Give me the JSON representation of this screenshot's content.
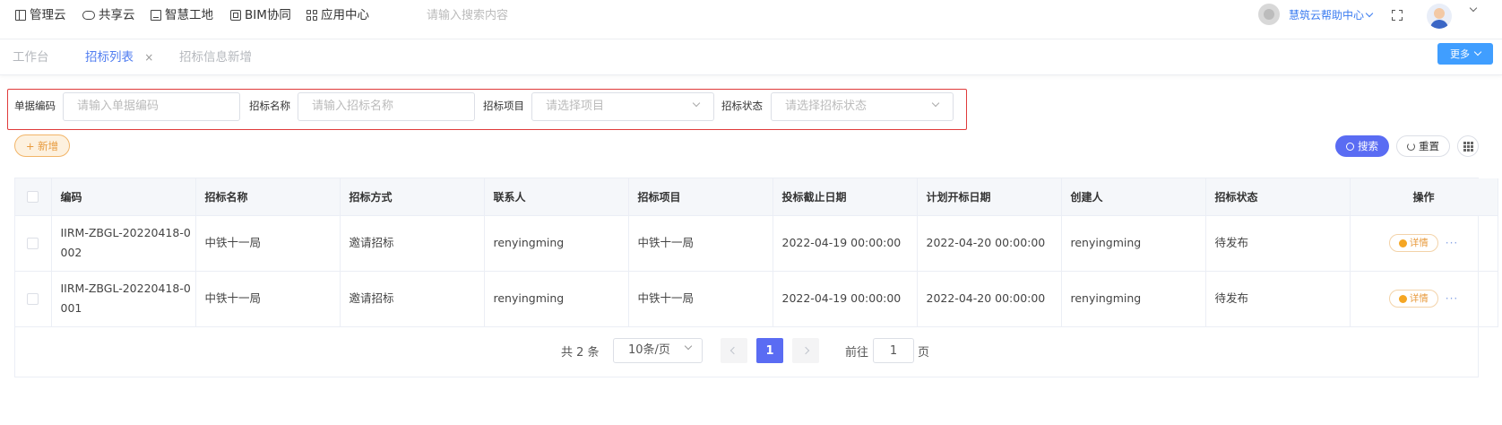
{
  "topnav": {
    "items": [
      {
        "label": "管理云",
        "icon": "book-icon"
      },
      {
        "label": "共享云",
        "icon": "cloud-icon"
      },
      {
        "label": "智慧工地",
        "icon": "site-icon"
      },
      {
        "label": "BIM协同",
        "icon": "bim-icon"
      },
      {
        "label": "应用中心",
        "icon": "grid-icon"
      }
    ],
    "search_placeholder": "请输入搜索内容",
    "help_label": "慧筑云帮助中心"
  },
  "tabs": {
    "items": [
      {
        "label": "工作台",
        "active": false
      },
      {
        "label": "招标列表",
        "active": true,
        "close": "×"
      },
      {
        "label": "招标信息新增",
        "active": false
      }
    ],
    "more_label": "更多"
  },
  "filters": {
    "code_label": "单据编码",
    "code_placeholder": "请输入单据编码",
    "name_label": "招标名称",
    "name_placeholder": "请输入招标名称",
    "project_label": "招标项目",
    "project_placeholder": "请选择项目",
    "status_label": "招标状态",
    "status_placeholder": "请选择招标状态"
  },
  "actions": {
    "add_label": "+ 新增",
    "search_label": "搜索",
    "reset_label": "重置"
  },
  "table": {
    "columns": [
      "编码",
      "招标名称",
      "招标方式",
      "联系人",
      "招标项目",
      "投标截止日期",
      "计划开标日期",
      "创建人",
      "招标状态",
      "操作"
    ],
    "rows": [
      {
        "code": "IIRM-ZBGL-20220418-0002",
        "name": "中铁十一局",
        "method": "邀请招标",
        "contact": "renyingming",
        "project": "中铁十一局",
        "deadline": "2022-04-19 00:00:00",
        "open_date": "2022-04-20 00:00:00",
        "creator": "renyingming",
        "status": "待发布"
      },
      {
        "code": "IIRM-ZBGL-20220418-0001",
        "name": "中铁十一局",
        "method": "邀请招标",
        "contact": "renyingming",
        "project": "中铁十一局",
        "deadline": "2022-04-19 00:00:00",
        "open_date": "2022-04-20 00:00:00",
        "creator": "renyingming",
        "status": "待发布"
      }
    ],
    "detail_label": "详情",
    "more_dots": "···"
  },
  "pagination": {
    "total_text": "共 2 条",
    "page_size": "10条/页",
    "current_page": "1",
    "goto_label": "前往",
    "goto_value": "1",
    "unit_label": "页"
  },
  "colors": {
    "accent": "#5a6cf3",
    "tab_active": "#4f7cf0",
    "add_orange": "#e89b3e",
    "filter_border": "#e03b3b",
    "more_blue": "#409eff"
  }
}
